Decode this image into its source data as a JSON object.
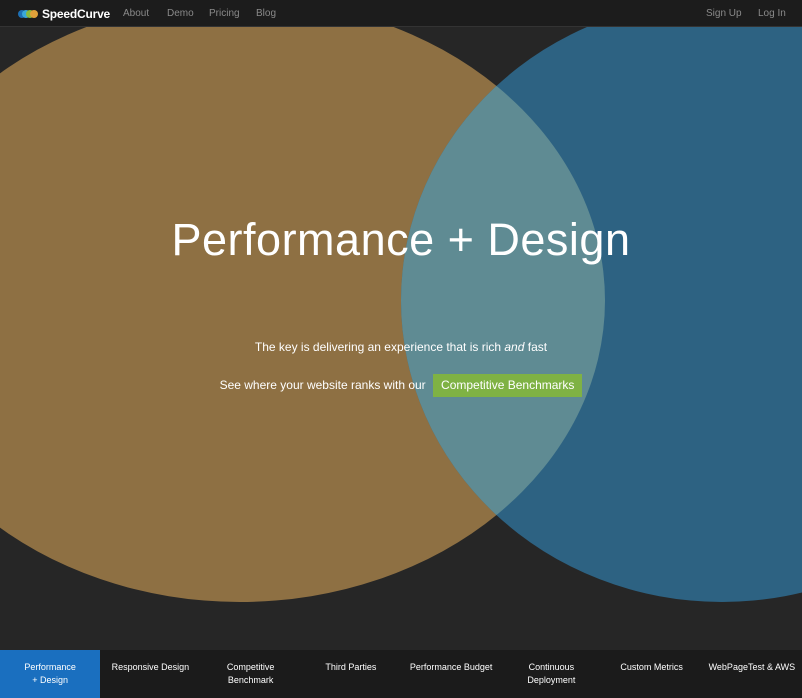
{
  "nav": {
    "brand": "SpeedCurve",
    "links": [
      "About",
      "Demo",
      "Pricing",
      "Blog"
    ],
    "right_links": [
      "Sign Up",
      "Log In"
    ]
  },
  "hero": {
    "title": "Performance + Design",
    "tagline_before": "The key is delivering an experience that is rich ",
    "tagline_em": "and",
    "tagline_after": " fast",
    "cta_text": "See where your website ranks with our",
    "cta_button": "Competitive Benchmarks"
  },
  "tabs": [
    {
      "line1": "Performance",
      "line2": "+ Design",
      "active": true
    },
    {
      "line1": "Responsive Design",
      "line2": ""
    },
    {
      "line1": "Competitive",
      "line2": "Benchmark"
    },
    {
      "line1": "Third Parties",
      "line2": ""
    },
    {
      "line1": "Performance Budget",
      "line2": ""
    },
    {
      "line1": "Continuous",
      "line2": "Deployment"
    },
    {
      "line1": "Custom Metrics",
      "line2": ""
    },
    {
      "line1": "WebPageTest & AWS",
      "line2": ""
    }
  ],
  "colors": {
    "background": "#262626",
    "orange_circle": "#8e7043",
    "blue_circle": "#2d6282",
    "overlap": "#5f8b93",
    "cta_green": "#7fb244",
    "active_tab": "#1a6fbf"
  }
}
